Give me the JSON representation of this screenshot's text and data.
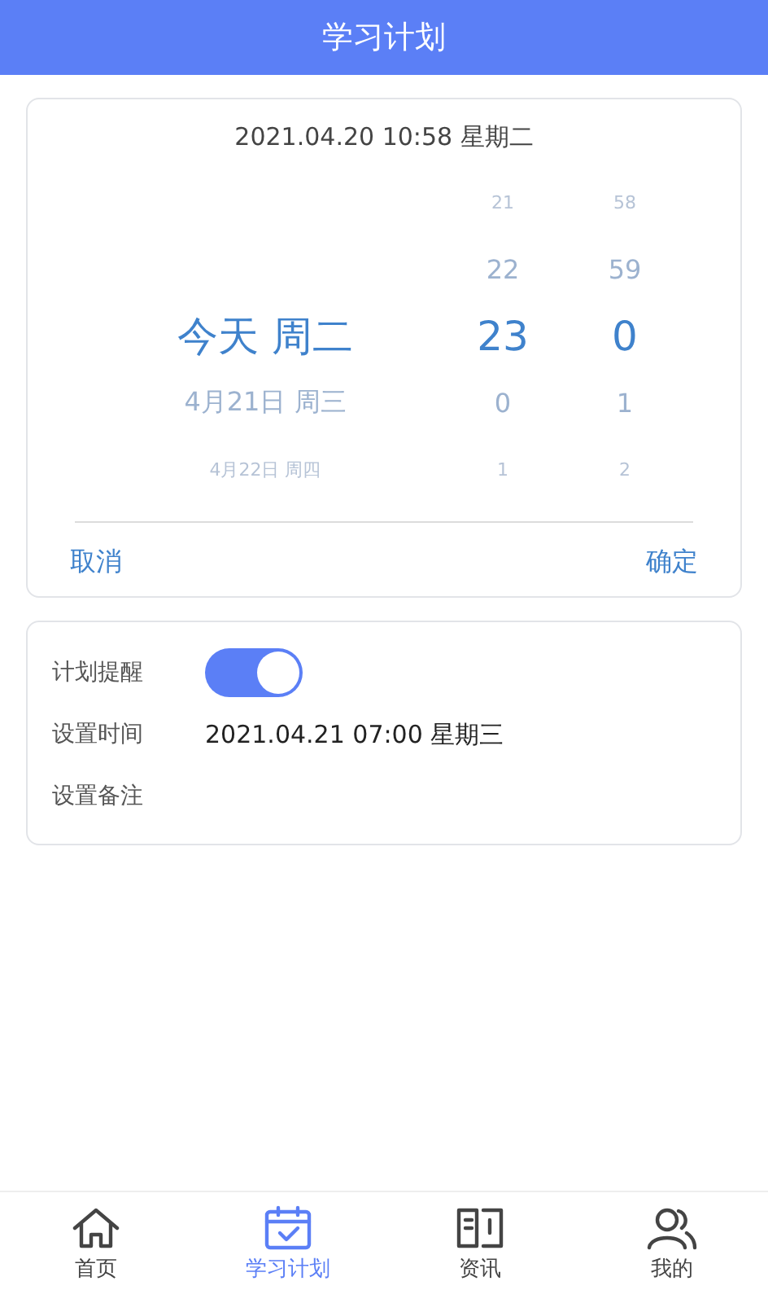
{
  "header": {
    "title": "学习计划"
  },
  "picker": {
    "current": "2021.04.20 10:58 星期二",
    "rows": [
      {
        "hour": "21",
        "minute": "58",
        "selected": false
      },
      {
        "hour": "22",
        "minute": "59",
        "selected": false
      },
      {
        "date": "今天 周二",
        "hour": "23",
        "minute": "0",
        "selected": true
      },
      {
        "date": "4月21日 周三",
        "hour": "0",
        "minute": "1",
        "selected": false
      },
      {
        "date": "4月22日 周四",
        "hour": "1",
        "minute": "2",
        "selected": false
      }
    ],
    "cancel": "取消",
    "confirm": "确定"
  },
  "settings": [
    {
      "kind": "toggle",
      "label": "计划提醒",
      "on": true
    },
    {
      "kind": "text",
      "label": "设置时间",
      "value": "2021.04.21 07:00 星期三"
    },
    {
      "kind": "text",
      "label": "设置备注"
    }
  ],
  "tabs": [
    {
      "label": "首页",
      "selected": false
    },
    {
      "label": "学习计划",
      "selected": true
    },
    {
      "label": "资讯",
      "selected": false
    },
    {
      "label": "我的",
      "selected": false
    }
  ]
}
